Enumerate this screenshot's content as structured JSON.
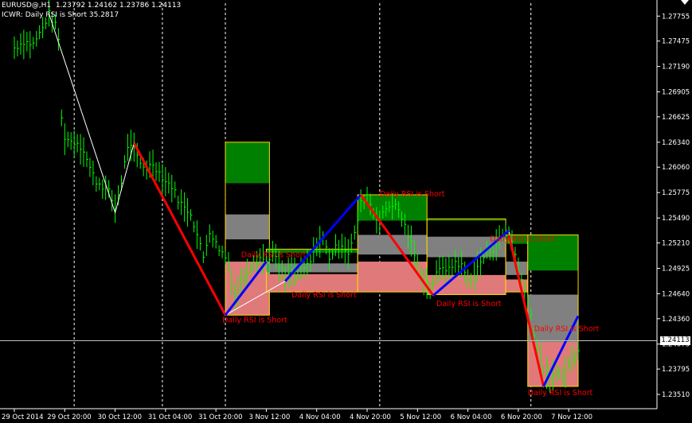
{
  "header": {
    "symbol_line": "EURUSD@,H1  1.23792 1.24162 1.23786 1.24113",
    "indicator_line": "ICWR: Daily RSI is Short 35.2817"
  },
  "current_price": "1.24113",
  "colors": {
    "background": "#000000",
    "candle": "#00ff00",
    "grid": "#ffffff",
    "wave_down": "#ff0000",
    "wave_up": "#0000ff",
    "target_box": "#008000",
    "mid_box": "#808080",
    "retrace_box": "#e07a7a",
    "zone_edge": "#ffd700",
    "label": "#ff0000"
  },
  "chart_data": {
    "type": "line",
    "title": "",
    "xlabel": "",
    "ylabel": "",
    "ylim": [
      1.2335,
      1.279
    ],
    "yticks": [
      1.27755,
      1.27475,
      1.2719,
      1.26905,
      1.26625,
      1.2634,
      1.2606,
      1.25775,
      1.2549,
      1.2521,
      1.24925,
      1.2464,
      1.2436,
      1.24075,
      1.23795,
      1.2351
    ],
    "x_tick_labels": [
      "29 Oct 2014",
      "29 Oct 20:00",
      "30 Oct 12:00",
      "31 Oct 04:00",
      "31 Oct 20:00",
      "3 Nov 12:00",
      "4 Nov 04:00",
      "4 Nov 20:00",
      "5 Nov 12:00",
      "6 Nov 04:00",
      "6 Nov 20:00",
      "7 Nov 12:00"
    ],
    "x_tick_bars": [
      0,
      16,
      32,
      48,
      64,
      80,
      96,
      112,
      128,
      144,
      160,
      176
    ],
    "vertical_grid_bars": [
      19,
      47,
      67,
      116,
      164
    ],
    "bars_total": 181,
    "price_series": [
      {
        "bar": 0,
        "v": 1.274
      },
      {
        "bar": 3,
        "v": 1.2747
      },
      {
        "bar": 6,
        "v": 1.2744
      },
      {
        "bar": 9,
        "v": 1.2762
      },
      {
        "bar": 11,
        "v": 1.2778
      },
      {
        "bar": 13,
        "v": 1.2765
      },
      {
        "bar": 14,
        "v": 1.275
      },
      {
        "bar": 15,
        "v": 1.266
      },
      {
        "bar": 16,
        "v": 1.264
      },
      {
        "bar": 18,
        "v": 1.2635
      },
      {
        "bar": 20,
        "v": 1.2634
      },
      {
        "bar": 22,
        "v": 1.2625
      },
      {
        "bar": 24,
        "v": 1.2605
      },
      {
        "bar": 26,
        "v": 1.259
      },
      {
        "bar": 28,
        "v": 1.2585
      },
      {
        "bar": 30,
        "v": 1.2578
      },
      {
        "bar": 32,
        "v": 1.256
      },
      {
        "bar": 34,
        "v": 1.259
      },
      {
        "bar": 36,
        "v": 1.263
      },
      {
        "bar": 38,
        "v": 1.2625
      },
      {
        "bar": 40,
        "v": 1.261
      },
      {
        "bar": 42,
        "v": 1.2605
      },
      {
        "bar": 44,
        "v": 1.261
      },
      {
        "bar": 46,
        "v": 1.26
      },
      {
        "bar": 48,
        "v": 1.259
      },
      {
        "bar": 50,
        "v": 1.2585
      },
      {
        "bar": 52,
        "v": 1.257
      },
      {
        "bar": 54,
        "v": 1.256
      },
      {
        "bar": 56,
        "v": 1.2555
      },
      {
        "bar": 58,
        "v": 1.253
      },
      {
        "bar": 60,
        "v": 1.2505
      },
      {
        "bar": 62,
        "v": 1.2535
      },
      {
        "bar": 64,
        "v": 1.252
      },
      {
        "bar": 66,
        "v": 1.251
      },
      {
        "bar": 68,
        "v": 1.25
      },
      {
        "bar": 70,
        "v": 1.246
      },
      {
        "bar": 72,
        "v": 1.2478
      },
      {
        "bar": 74,
        "v": 1.249
      },
      {
        "bar": 76,
        "v": 1.25
      },
      {
        "bar": 78,
        "v": 1.2505
      },
      {
        "bar": 80,
        "v": 1.25
      },
      {
        "bar": 82,
        "v": 1.251
      },
      {
        "bar": 84,
        "v": 1.2495
      },
      {
        "bar": 86,
        "v": 1.248
      },
      {
        "bar": 88,
        "v": 1.249
      },
      {
        "bar": 90,
        "v": 1.2485
      },
      {
        "bar": 92,
        "v": 1.2492
      },
      {
        "bar": 94,
        "v": 1.25
      },
      {
        "bar": 96,
        "v": 1.252
      },
      {
        "bar": 98,
        "v": 1.2525
      },
      {
        "bar": 100,
        "v": 1.2505
      },
      {
        "bar": 102,
        "v": 1.2515
      },
      {
        "bar": 104,
        "v": 1.252
      },
      {
        "bar": 106,
        "v": 1.251
      },
      {
        "bar": 108,
        "v": 1.253
      },
      {
        "bar": 110,
        "v": 1.2565
      },
      {
        "bar": 112,
        "v": 1.2575
      },
      {
        "bar": 114,
        "v": 1.2555
      },
      {
        "bar": 116,
        "v": 1.2545
      },
      {
        "bar": 118,
        "v": 1.256
      },
      {
        "bar": 120,
        "v": 1.2565
      },
      {
        "bar": 122,
        "v": 1.2558
      },
      {
        "bar": 124,
        "v": 1.254
      },
      {
        "bar": 126,
        "v": 1.252
      },
      {
        "bar": 128,
        "v": 1.2495
      },
      {
        "bar": 130,
        "v": 1.248
      },
      {
        "bar": 132,
        "v": 1.247
      },
      {
        "bar": 134,
        "v": 1.2485
      },
      {
        "bar": 136,
        "v": 1.2495
      },
      {
        "bar": 138,
        "v": 1.249
      },
      {
        "bar": 140,
        "v": 1.25
      },
      {
        "bar": 142,
        "v": 1.2495
      },
      {
        "bar": 144,
        "v": 1.248
      },
      {
        "bar": 146,
        "v": 1.2485
      },
      {
        "bar": 148,
        "v": 1.25
      },
      {
        "bar": 150,
        "v": 1.251
      },
      {
        "bar": 152,
        "v": 1.2515
      },
      {
        "bar": 154,
        "v": 1.2525
      },
      {
        "bar": 156,
        "v": 1.2535
      },
      {
        "bar": 158,
        "v": 1.2525
      },
      {
        "bar": 160,
        "v": 1.249
      },
      {
        "bar": 162,
        "v": 1.247
      },
      {
        "bar": 164,
        "v": 1.244
      },
      {
        "bar": 166,
        "v": 1.24
      },
      {
        "bar": 168,
        "v": 1.238
      },
      {
        "bar": 170,
        "v": 1.2365
      },
      {
        "bar": 172,
        "v": 1.2378
      },
      {
        "bar": 174,
        "v": 1.237
      },
      {
        "bar": 176,
        "v": 1.2385
      },
      {
        "bar": 178,
        "v": 1.2395
      },
      {
        "bar": 180,
        "v": 1.2411
      }
    ],
    "zigzag": [
      {
        "bar": 11,
        "v": 1.2778
      },
      {
        "bar": 32,
        "v": 1.2555
      },
      {
        "bar": 38,
        "v": 1.2633
      },
      {
        "bar": 67,
        "v": 1.244
      },
      {
        "bar": 86,
        "v": 1.2478
      },
      {
        "bar": 110,
        "v": 1.2575
      },
      {
        "bar": 133,
        "v": 1.2462
      },
      {
        "bar": 157,
        "v": 1.2535
      },
      {
        "bar": 168,
        "v": 1.236
      },
      {
        "bar": 179,
        "v": 1.2439
      }
    ],
    "waves": [
      {
        "dir": "down",
        "from": {
          "bar": 38,
          "v": 1.2633
        },
        "to": {
          "bar": 67,
          "v": 1.244
        }
      },
      {
        "dir": "up",
        "from": {
          "bar": 67,
          "v": 1.244
        },
        "to": {
          "bar": 80,
          "v": 1.25
        }
      },
      {
        "dir": "up",
        "from": {
          "bar": 86,
          "v": 1.2478
        },
        "to": {
          "bar": 110,
          "v": 1.2575
        }
      },
      {
        "dir": "down",
        "from": {
          "bar": 110,
          "v": 1.2575
        },
        "to": {
          "bar": 133,
          "v": 1.2462
        }
      },
      {
        "dir": "up",
        "from": {
          "bar": 133,
          "v": 1.2462
        },
        "to": {
          "bar": 157,
          "v": 1.2535
        }
      },
      {
        "dir": "down",
        "from": {
          "bar": 157,
          "v": 1.253
        },
        "to": {
          "bar": 168,
          "v": 1.236
        }
      },
      {
        "dir": "up",
        "from": {
          "bar": 168,
          "v": 1.236
        },
        "to": {
          "bar": 179,
          "v": 1.2439
        }
      }
    ],
    "zones": [
      {
        "x1": 67,
        "x2": 81,
        "green": [
          1.2588,
          1.2634
        ],
        "gray": [
          1.2525,
          1.2553
        ],
        "pink": [
          1.244,
          1.25
        ]
      },
      {
        "x1": 80,
        "x2": 109,
        "green": [
          1.251,
          1.2514
        ],
        "gray": [
          1.2488,
          1.2498
        ],
        "pink": [
          1.2466,
          1.2486
        ]
      },
      {
        "x1": 109,
        "x2": 131,
        "green": [
          1.2546,
          1.2575
        ],
        "gray": [
          1.2508,
          1.253
        ],
        "pink": [
          1.2466,
          1.25
        ]
      },
      {
        "x1": 131,
        "x2": 156,
        "green": [
          1.2546,
          1.2548
        ],
        "gray": [
          1.2505,
          1.2528
        ],
        "pink": [
          1.2463,
          1.2485
        ]
      },
      {
        "x1": 156,
        "x2": 163,
        "green": [
          1.252,
          1.253
        ],
        "gray": [
          1.2485,
          1.25
        ],
        "pink": [
          1.2466,
          1.248
        ]
      },
      {
        "x1": 163,
        "x2": 179,
        "green": [
          1.249,
          1.253
        ],
        "gray": [
          1.241,
          1.2463
        ],
        "pink": [
          1.236,
          1.241
        ]
      }
    ],
    "annotations": [
      {
        "text": "Daily RSI is Short",
        "bar": 72,
        "v": 1.2505
      },
      {
        "text": "Daily RSI is Short",
        "bar": 66,
        "v": 1.2432
      },
      {
        "text": "Daily RSI is Short",
        "bar": 88,
        "v": 1.246
      },
      {
        "text": "Daily RSI is Short",
        "bar": 116,
        "v": 1.2573
      },
      {
        "text": "Daily RSI is Short",
        "bar": 134,
        "v": 1.245
      },
      {
        "text": "Daily RSI is Short",
        "bar": 151,
        "v": 1.2523
      },
      {
        "text": "Daily RSI is Short",
        "bar": 165,
        "v": 1.2422
      },
      {
        "text": "Daily RSI is Short",
        "bar": 163,
        "v": 1.235
      }
    ]
  }
}
